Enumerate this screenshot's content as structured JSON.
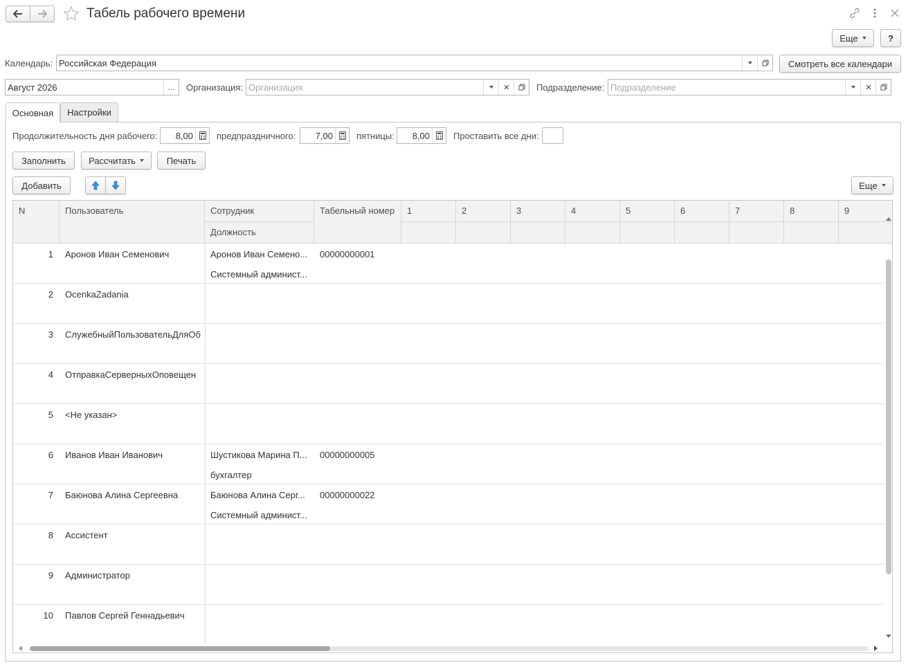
{
  "window": {
    "title": "Табель рабочего времени",
    "more_label": "Еще",
    "help_label": "?"
  },
  "calendar": {
    "label": "Календарь:",
    "value": "Российская Федерация",
    "view_all_label": "Смотреть все календари"
  },
  "period": {
    "value": "Август 2026",
    "select_label": "..."
  },
  "organization": {
    "label": "Организация:",
    "placeholder": "Организация"
  },
  "department": {
    "label": "Подразделение:",
    "placeholder": "Подразделение"
  },
  "tabs": [
    {
      "label": "Основная"
    },
    {
      "label": "Настройки"
    }
  ],
  "durations": {
    "workday_label": "Продолжительность дня рабочего:",
    "workday_value": "8,00",
    "preholiday_label": "предпраздничного:",
    "preholiday_value": "7,00",
    "friday_label": "пятницы:",
    "friday_value": "8,00",
    "set_all_label": "Проставить все дни:"
  },
  "toolbar": {
    "fill_label": "Заполнить",
    "calculate_label": "Рассчитать",
    "print_label": "Печать",
    "add_label": "Добавить",
    "more_label": "Еще"
  },
  "table": {
    "headers": {
      "n": "N",
      "user": "Пользователь",
      "employee": "Сотрудник",
      "position": "Должность",
      "tab_number": "Табельный номер",
      "days": [
        "1",
        "2",
        "3",
        "4",
        "5",
        "6",
        "7",
        "8",
        "9"
      ]
    },
    "rows": [
      {
        "n": "1",
        "user": "Аронов Иван Семенович",
        "employee": "Аронов Иван Семено...",
        "position": "Системный админист...",
        "tab_number": "00000000001"
      },
      {
        "n": "2",
        "user": "OcenkaZadania",
        "employee": "",
        "position": "",
        "tab_number": ""
      },
      {
        "n": "3",
        "user": "СлужебныйПользовательДляОб",
        "employee": "",
        "position": "",
        "tab_number": ""
      },
      {
        "n": "4",
        "user": "ОтправкаСерверныхОповещен",
        "employee": "",
        "position": "",
        "tab_number": ""
      },
      {
        "n": "5",
        "user": "<Не указан>",
        "employee": "",
        "position": "",
        "tab_number": ""
      },
      {
        "n": "6",
        "user": "Иванов Иван Иванович",
        "employee": "Шустикова Марина П...",
        "position": "бухгалтер",
        "tab_number": "00000000005"
      },
      {
        "n": "7",
        "user": "Баюнова Алина Сергеевна",
        "employee": "Баюнова Алина Серг...",
        "position": "Системный админист...",
        "tab_number": "00000000022"
      },
      {
        "n": "8",
        "user": "Ассистент",
        "employee": "",
        "position": "",
        "tab_number": ""
      },
      {
        "n": "9",
        "user": "Администратор",
        "employee": "",
        "position": "",
        "tab_number": ""
      },
      {
        "n": "10",
        "user": "Павлов Сергей Геннадьевич",
        "employee": "",
        "position": "",
        "tab_number": ""
      }
    ]
  }
}
